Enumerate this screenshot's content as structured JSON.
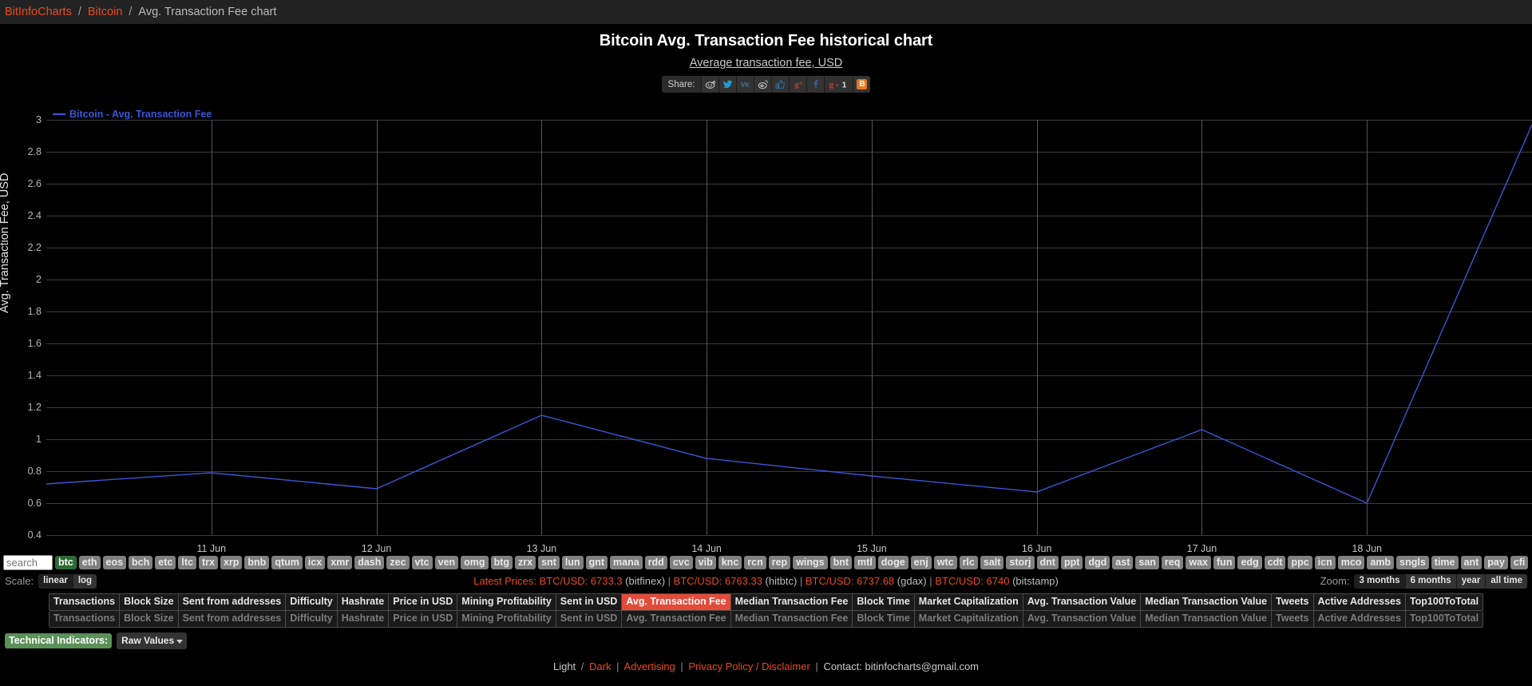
{
  "breadcrumb": {
    "items": [
      {
        "label": "BitInfoCharts",
        "type": "link"
      },
      {
        "label": "Bitcoin",
        "type": "link"
      },
      {
        "label": "Avg. Transaction Fee chart",
        "type": "current"
      }
    ],
    "separator": "/"
  },
  "header": {
    "title": "Bitcoin Avg. Transaction Fee historical chart",
    "subtitle": "Average transaction fee, USD"
  },
  "share": {
    "label": "Share:",
    "buttons": [
      {
        "name": "reddit",
        "glyph": "Ⓡ"
      },
      {
        "name": "twitter",
        "glyph": "ᵥ"
      },
      {
        "name": "vk",
        "glyph": "vk"
      },
      {
        "name": "weibo",
        "glyph": "海"
      },
      {
        "name": "odnoklassniki",
        "glyph": "ὄD"
      },
      {
        "name": "google-plus",
        "glyph": "g⁺"
      },
      {
        "name": "facebook",
        "glyph": "f"
      },
      {
        "name": "google-plus-one",
        "glyph": "g+1"
      },
      {
        "name": "blogger",
        "glyph": "B"
      }
    ]
  },
  "chart_data": {
    "type": "line",
    "title": "Bitcoin Avg. Transaction Fee historical chart",
    "subtitle": "Average transaction fee, USD",
    "xlabel": "",
    "ylabel": "Avg. Transaction Fee, USD",
    "ylim": [
      0.4,
      3.0
    ],
    "yticks": [
      3,
      2.8,
      2.6,
      2.4,
      2.2,
      2,
      1.8,
      1.6,
      1.4,
      1.2,
      1,
      0.8,
      0.6,
      0.4
    ],
    "ytick_labels": [
      "3",
      "2.8",
      "2.6",
      "2.4",
      "2.2",
      "2",
      "1.8",
      "1.6",
      "1.4",
      "1.2",
      "1",
      "0.8",
      "0.6",
      "0.4"
    ],
    "xticks": [
      "11 Jun",
      "12 Jun",
      "13 Jun",
      "14 Jun",
      "15 Jun",
      "16 Jun",
      "17 Jun",
      "18 Jun"
    ],
    "grid": true,
    "legend_position": "top-left",
    "series": [
      {
        "name": "Bitcoin - Avg. Transaction Fee",
        "color": "#3b55d4",
        "x": [
          "10 Jun",
          "11 Jun",
          "12 Jun",
          "13 Jun",
          "14 Jun",
          "15 Jun",
          "16 Jun",
          "17 Jun",
          "18 Jun",
          "19 Jun"
        ],
        "values": [
          0.72,
          0.79,
          0.69,
          1.15,
          0.88,
          0.77,
          0.67,
          1.06,
          0.6,
          2.97
        ]
      }
    ]
  },
  "coins": {
    "search_placeholder": "search",
    "search_value": "",
    "active": "btc",
    "tickers": [
      "btc",
      "eth",
      "eos",
      "bch",
      "etc",
      "ltc",
      "trx",
      "xrp",
      "bnb",
      "qtum",
      "icx",
      "xmr",
      "dash",
      "zec",
      "vtc",
      "ven",
      "omg",
      "btg",
      "zrx",
      "snt",
      "lun",
      "gnt",
      "mana",
      "rdd",
      "cvc",
      "vib",
      "knc",
      "rcn",
      "rep",
      "wings",
      "bnt",
      "mtl",
      "doge",
      "enj",
      "wtc",
      "rlc",
      "salt",
      "storj",
      "dnt",
      "ppt",
      "dgd",
      "ast",
      "san",
      "req",
      "wax",
      "fun",
      "edg",
      "cdt",
      "ppc",
      "icn",
      "mco",
      "amb",
      "sngls",
      "time",
      "ant",
      "pay",
      "cfi"
    ]
  },
  "scale": {
    "label": "Scale:",
    "options": [
      "linear",
      "log"
    ],
    "selected": "linear"
  },
  "prices": {
    "label": "Latest Prices:",
    "entries": [
      {
        "pair": "BTC/USD: 6733.3",
        "exchange": "(bitfinex)"
      },
      {
        "pair": "BTC/USD: 6763.33",
        "exchange": "(hitbtc)"
      },
      {
        "pair": "BTC/USD: 6737.68",
        "exchange": "(gdax)"
      },
      {
        "pair": "BTC/USD: 6740",
        "exchange": "(bitstamp)"
      }
    ],
    "separator": "|"
  },
  "zoom": {
    "label": "Zoom:",
    "options": [
      "3 months",
      "6 months",
      "year",
      "all time"
    ],
    "selected": "3 months"
  },
  "metric_tabs": {
    "active": "Avg. Transaction Fee",
    "items": [
      "Transactions",
      "Block Size",
      "Sent from addresses",
      "Difficulty",
      "Hashrate",
      "Price in USD",
      "Mining Profitability",
      "Sent in USD",
      "Avg. Transaction Fee",
      "Median Transaction Fee",
      "Block Time",
      "Market Capitalization",
      "Avg. Transaction Value",
      "Median Transaction Value",
      "Tweets",
      "Active Addresses",
      "Top100ToTotal"
    ]
  },
  "technical_indicators": {
    "label": "Technical Indicators:",
    "selected": "Raw Values"
  },
  "footer": {
    "light": "Light",
    "slash": "/",
    "dark": "Dark",
    "advertising": "Advertising",
    "privacy": "Privacy Policy / Disclaimer",
    "contact_prefix": "Contact:",
    "contact_email": "bitinfocharts@gmail.com",
    "sep": "|"
  },
  "colors": {
    "accent": "#e8491d",
    "line": "#3b55d4",
    "active_tab": "#e34a3a",
    "active_coin": "#2d6a34",
    "indicator_label": "#5a9158"
  }
}
